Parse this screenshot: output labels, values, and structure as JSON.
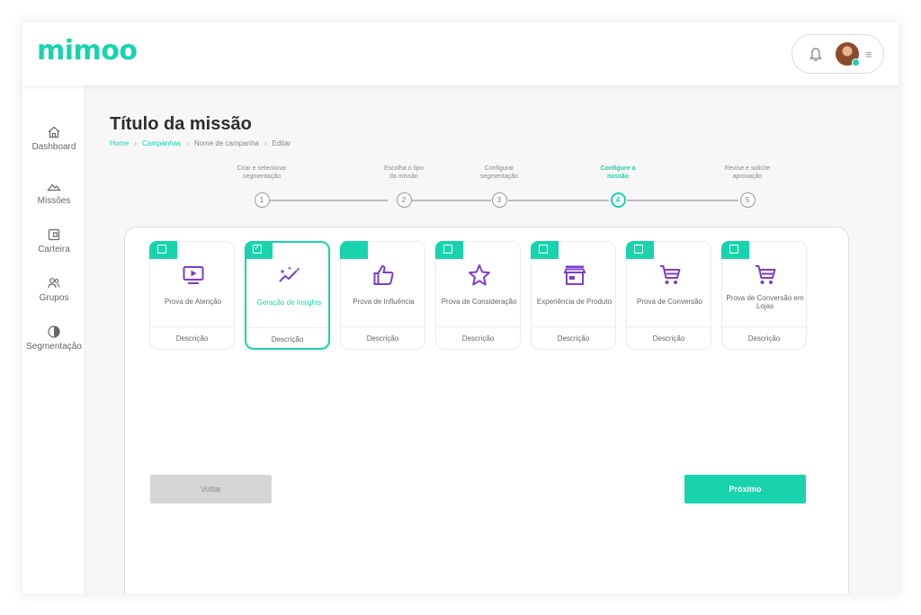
{
  "brand": {
    "logo_text": "mimoo",
    "accent": "#19d3ad",
    "icon_purple": "#7b3fc4"
  },
  "header": {
    "bell_icon": "bell-icon",
    "avatar": "user-avatar",
    "menu_icon": "hamburger-icon",
    "menu_glyph": "≡"
  },
  "sidebar": {
    "items": [
      {
        "label": "Dashboard",
        "icon": "home-icon"
      },
      {
        "label": "Missões",
        "icon": "mountain-icon"
      },
      {
        "label": "Carteira",
        "icon": "wallet-icon"
      },
      {
        "label": "Grupos",
        "icon": "users-icon"
      },
      {
        "label": "Segmentação",
        "icon": "pie-chart-icon"
      }
    ]
  },
  "page": {
    "title": "Título da missão",
    "breadcrumb": {
      "home": "Home",
      "campaigns": "Campanhas",
      "campaign_name": "Nome de campanha",
      "edit": "Editar",
      "separator": "›"
    }
  },
  "stepper": {
    "steps": [
      {
        "label": "Criar e selecionar\nsegmentação",
        "number": "1"
      },
      {
        "label": "Escolha o tipo\nda missão",
        "number": "2"
      },
      {
        "label": "Configurar\nsegmentação",
        "number": "3"
      },
      {
        "label": "Configure a\nmissão",
        "number": "4",
        "active": true
      },
      {
        "label": "Revise e solicite\naprovação",
        "number": "5"
      }
    ]
  },
  "cards": [
    {
      "name": "Prova de Atenção",
      "description": "Descrição",
      "icon": "play-screen-icon",
      "checkbox": true,
      "checked": false
    },
    {
      "name": "Geração de Insights",
      "description": "Descrição",
      "icon": "sparkle-chart-icon",
      "checkbox": true,
      "checked": true,
      "check_glyph": "✓"
    },
    {
      "name": "Prova de Influência",
      "description": "Descrição",
      "icon": "thumbs-up-icon",
      "checkbox": false,
      "checked": false
    },
    {
      "name": "Prova de Consideração",
      "description": "Descrição",
      "icon": "star-icon",
      "checkbox": true,
      "checked": false
    },
    {
      "name": "Experiência de Produto",
      "description": "Descrição",
      "icon": "storefront-icon",
      "checkbox": true,
      "checked": false
    },
    {
      "name": "Prova de Conversão",
      "description": "Descrição",
      "icon": "cart-icon",
      "checkbox": true,
      "checked": false
    },
    {
      "name": "Prova de Conversão em Lojas",
      "description": "Descrição",
      "icon": "cart-icon",
      "checkbox": true,
      "checked": false
    }
  ],
  "actions": {
    "back_label": "Voltar",
    "next_label": "Próximo"
  }
}
